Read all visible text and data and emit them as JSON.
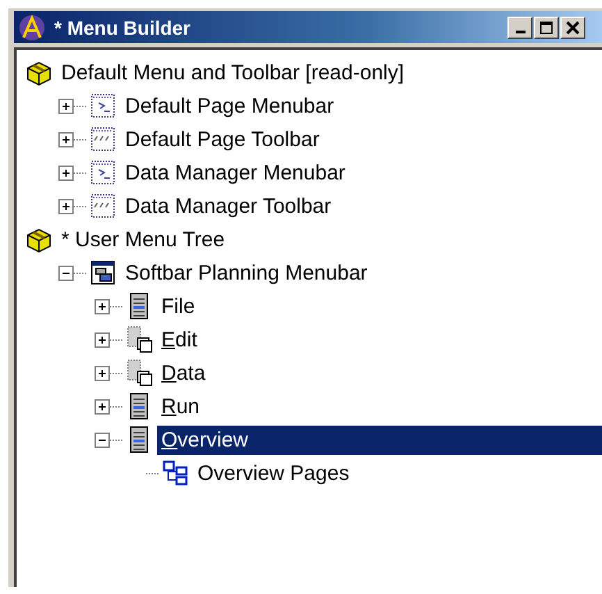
{
  "window": {
    "title": "* Menu Builder"
  },
  "tree": [
    {
      "label": "Default Menu and Toolbar [read-only]",
      "kind": "box",
      "underline_first": false,
      "selected": false,
      "children": [
        {
          "label": "Default Page Menubar",
          "kind": "menubar-dotted",
          "expanded": false,
          "underline_first": false,
          "selected": false
        },
        {
          "label": "Default Page Toolbar",
          "kind": "toolbar",
          "expanded": false,
          "underline_first": false,
          "selected": false
        },
        {
          "label": "Data Manager Menubar",
          "kind": "menubar-dotted",
          "expanded": false,
          "underline_first": false,
          "selected": false
        },
        {
          "label": "Data Manager Toolbar",
          "kind": "toolbar",
          "expanded": false,
          "underline_first": false,
          "selected": false
        }
      ]
    },
    {
      "label": "* User Menu Tree",
      "kind": "box",
      "underline_first": false,
      "selected": false,
      "children": [
        {
          "label": "Softbar Planning Menubar",
          "kind": "menubar",
          "expanded": true,
          "underline_first": false,
          "selected": false,
          "children": [
            {
              "label": "File",
              "kind": "menu",
              "expanded": false,
              "underline_first": false,
              "selected": false
            },
            {
              "label": "Edit",
              "kind": "submenu",
              "expanded": false,
              "underline_first": true,
              "selected": false
            },
            {
              "label": "Data",
              "kind": "submenu",
              "expanded": false,
              "underline_first": true,
              "selected": false
            },
            {
              "label": "Run",
              "kind": "menu",
              "expanded": false,
              "underline_first": true,
              "selected": false
            },
            {
              "label": "Overview",
              "kind": "menu",
              "expanded": true,
              "underline_first": true,
              "selected": true,
              "children": [
                {
                  "label": "Overview Pages",
                  "kind": "pages",
                  "underline_first": false,
                  "selected": false
                }
              ]
            }
          ]
        }
      ]
    }
  ]
}
